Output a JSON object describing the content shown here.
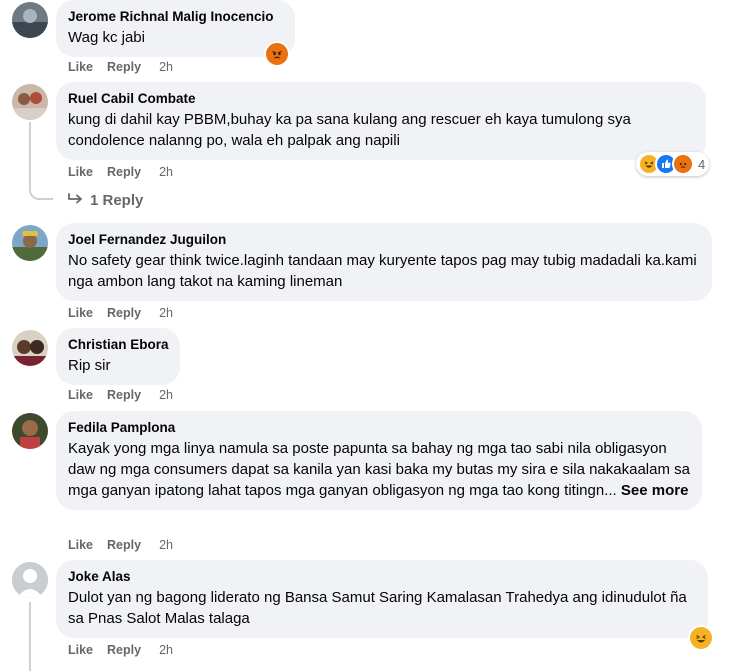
{
  "colors": {
    "bubble": "#f0f2f5",
    "meta_text": "#65676b",
    "haha": "#f7b125",
    "like": "#1877f2",
    "angry": "#e9710f"
  },
  "comments": [
    {
      "author": "Jerome Richnal Malig Inocencio",
      "text": "Wag kc jabi",
      "like": "Like",
      "reply": "Reply",
      "time": "2h",
      "reactions": [
        "angry-icon"
      ]
    },
    {
      "author": "Ruel Cabil Combate",
      "text": "kung di dahil kay PBBM,buhay ka pa sana kulang ang rescuer eh kaya tumulong sya condolence nalanng po, wala eh palpak ang napili",
      "like": "Like",
      "reply": "Reply",
      "time": "2h",
      "reactions": [
        "haha-icon",
        "like-icon",
        "angry-icon"
      ],
      "reaction_count": "4",
      "replies_label": "1 Reply"
    },
    {
      "author": "Joel Fernandez Juguilon",
      "text": "No safety gear think twice.laginh tandaan may kuryente tapos pag may tubig madadali ka.kami nga ambon lang takot na kaming lineman",
      "like": "Like",
      "reply": "Reply",
      "time": "2h"
    },
    {
      "author": "Christian Ebora",
      "text": "Rip sir",
      "like": "Like",
      "reply": "Reply",
      "time": "2h"
    },
    {
      "author": "Fedila Pamplona",
      "text": "Kayak yong mga linya namula sa poste papunta sa bahay ng mga tao sabi nila obligasyon daw ng mga consumers dapat sa kanila yan kasi baka my butas my sira e sila nakakaalam sa mga ganyan ipatong lahat tapos mga ganyan obligasyon ng mga tao kong titingn...",
      "see_more": "See more",
      "like": "Like",
      "reply": "Reply",
      "time": "2h"
    },
    {
      "author": "Joke Alas",
      "text": "Dulot yan ng bagong liderato ng Bansa Samut Saring Kamalasan Trahedya ang idinudulot ña sa Pnas Salot Malas talaga",
      "like": "Like",
      "reply": "Reply",
      "time": "2h",
      "reactions": [
        "haha-icon"
      ]
    }
  ]
}
